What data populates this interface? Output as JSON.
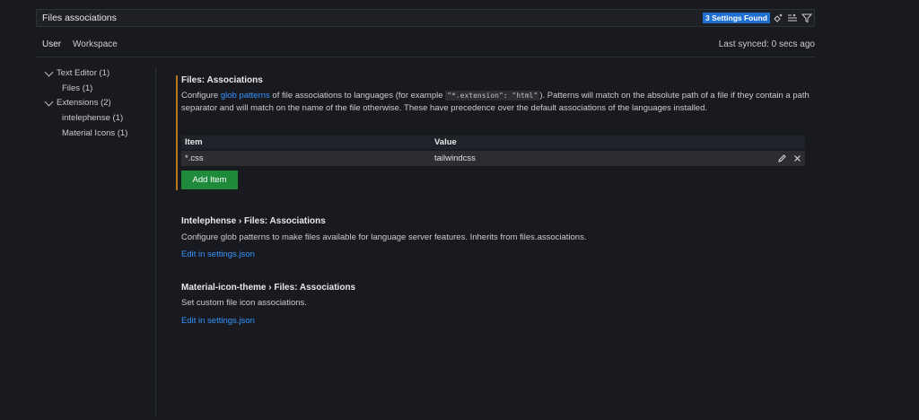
{
  "search": {
    "value": "Files associations",
    "results_badge": "3 Settings Found"
  },
  "tabs": {
    "user": "User",
    "workspace": "Workspace"
  },
  "sync": {
    "status": "Last synced: 0 secs ago"
  },
  "tree": [
    {
      "label": "Text Editor (1)",
      "expanded": true
    },
    {
      "label": "Files (1)"
    },
    {
      "label": "Extensions (2)",
      "expanded": true
    },
    {
      "label": "intelephense (1)"
    },
    {
      "label": "Material Icons (1)"
    }
  ],
  "settings": [
    {
      "title": "Files: Associations",
      "desc_pre": "Configure ",
      "desc_link": "glob patterns",
      "desc_mid": " of file associations to languages (for example ",
      "desc_code": "\"*.extension\": \"html\"",
      "desc_post": "). Patterns will match on the absolute path of a file if they contain a path separator and will match on the name of the file otherwise. These have precedence over the default associations of the languages installed.",
      "table": {
        "headers": [
          "Item",
          "Value"
        ],
        "rows": [
          {
            "item": "*.css",
            "value": "tailwindcss"
          }
        ]
      },
      "add_button": "Add Item",
      "modified_color": "#b07a19"
    },
    {
      "title": "Intelephense › Files: Associations",
      "desc": "Configure glob patterns to make files available for language server features. Inherits from files.associations.",
      "link": "Edit in settings.json"
    },
    {
      "title": "Material-icon-theme › Files: Associations",
      "desc": "Set custom file icon associations.",
      "link": "Edit in settings.json"
    }
  ],
  "icons": [
    "clear-filter-icon",
    "list-filter-icon",
    "filter-icon",
    "edit-icon",
    "remove-icon",
    "chevron-down-icon"
  ],
  "colors": {
    "accent": "#1f6fd1",
    "link": "#3794ff",
    "button": "#1e8a3a",
    "background": "#181a1f"
  }
}
